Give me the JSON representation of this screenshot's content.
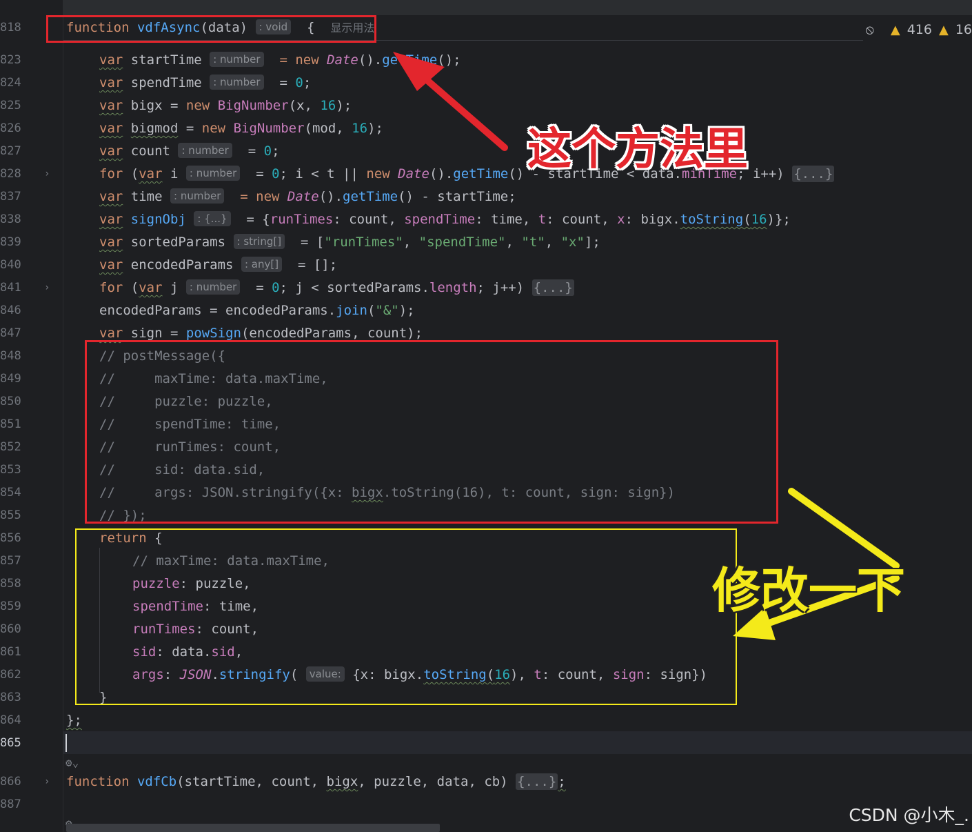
{
  "editor": {
    "inspection": {
      "warnings": "416",
      "weak_warnings": "16"
    },
    "sticky": {
      "line": "818",
      "tokens": [
        "function",
        "vdfAsync",
        "(data)",
        ": void",
        "{",
        "显示用法"
      ]
    },
    "lines": [
      {
        "n": "823",
        "t": [
          "var",
          "startTime",
          ": number",
          "= new",
          "Date",
          "().",
          "getTime",
          "();"
        ]
      },
      {
        "n": "824",
        "t": [
          "var",
          "spendTime",
          ": number",
          "=",
          "0",
          ";"
        ]
      },
      {
        "n": "825",
        "t": [
          "var",
          "bigx",
          "= new",
          "BigNumber",
          "(x,",
          "16",
          ");"
        ]
      },
      {
        "n": "826",
        "t": [
          "var",
          "bigmod",
          "= new",
          "BigNumber",
          "(mod,",
          "16",
          ");"
        ]
      },
      {
        "n": "827",
        "t": [
          "var",
          "count",
          ": number",
          "=",
          "0",
          ";"
        ]
      },
      {
        "n": "828",
        "t": [
          "for",
          "(",
          "var",
          "i",
          ": number",
          "=",
          "0",
          "; i < t ||",
          "new",
          "Date",
          "().",
          "getTime",
          "() - startTime < data.",
          "minTime",
          "; i++)",
          "{...}"
        ]
      },
      {
        "n": "837",
        "t": [
          "var",
          "time",
          ": number",
          "= new",
          "Date",
          "().",
          "getTime",
          "() - startTime;"
        ]
      },
      {
        "n": "838",
        "t": [
          "var",
          "signObj",
          ": {...}",
          "= {",
          "runTimes",
          ": count,",
          "spendTime",
          ": time,",
          "t",
          ": count,",
          "x",
          ": bigx.",
          "toString",
          "(",
          "16",
          ")};"
        ]
      },
      {
        "n": "839",
        "t": [
          "var",
          "sortedParams",
          ": string[]",
          "= [",
          "\"runTimes\"",
          ",",
          "\"spendTime\"",
          ",",
          "\"t\"",
          ",",
          "\"x\"",
          "];"
        ]
      },
      {
        "n": "840",
        "t": [
          "var",
          "encodedParams",
          ": any[]",
          "= [];"
        ]
      },
      {
        "n": "841",
        "t": [
          "for",
          "(",
          "var",
          "j",
          ": number",
          "=",
          "0",
          "; j < sortedParams.",
          "length",
          "; j++)",
          "{...}"
        ]
      },
      {
        "n": "846",
        "t": [
          "encodedParams = encodedParams.",
          "join",
          "(",
          "\"&\"",
          ");"
        ]
      },
      {
        "n": "847",
        "t": [
          "var",
          "sign =",
          "powSign",
          "(encodedParams, count);"
        ]
      },
      {
        "n": "848",
        "t": [
          "// postMessage({"
        ]
      },
      {
        "n": "849",
        "t": [
          "//     maxTime: data.maxTime,"
        ]
      },
      {
        "n": "850",
        "t": [
          "//     puzzle: puzzle,"
        ]
      },
      {
        "n": "851",
        "t": [
          "//     spendTime: time,"
        ]
      },
      {
        "n": "852",
        "t": [
          "//     runTimes: count,"
        ]
      },
      {
        "n": "853",
        "t": [
          "//     sid: data.sid,"
        ]
      },
      {
        "n": "854",
        "t": [
          "//     args: JSON.stringify({x: ",
          "bigx",
          ".toString(16), t: count, sign: sign})"
        ]
      },
      {
        "n": "855",
        "t": [
          "// });"
        ]
      },
      {
        "n": "856",
        "t": [
          "return",
          "{"
        ]
      },
      {
        "n": "857",
        "t": [
          "// maxTime: data.maxTime,"
        ]
      },
      {
        "n": "858",
        "t": [
          "puzzle",
          ": puzzle,"
        ]
      },
      {
        "n": "859",
        "t": [
          "spendTime",
          ": time,"
        ]
      },
      {
        "n": "860",
        "t": [
          "runTimes",
          ": count,"
        ]
      },
      {
        "n": "861",
        "t": [
          "sid",
          ": data.",
          "sid",
          ","
        ]
      },
      {
        "n": "862",
        "t": [
          "args",
          ":",
          "JSON",
          ".",
          "stringify",
          "(",
          "value:",
          "{x: bigx.",
          "toString",
          "(",
          "16",
          "),",
          "t",
          ": count,",
          "sign",
          ": sign})"
        ]
      },
      {
        "n": "863",
        "t": [
          "}"
        ]
      },
      {
        "n": "864",
        "t": [
          "};"
        ]
      },
      {
        "n": "865",
        "t": [
          ""
        ]
      },
      {
        "n": "866",
        "t": [
          "function",
          "vdfCb",
          "(startTime, count,",
          "bigx",
          ", puzzle, data, cb)",
          "{...}",
          ";"
        ]
      },
      {
        "n": "887",
        "t": [
          ""
        ]
      }
    ]
  },
  "annotations": {
    "red_label": "这个方法里",
    "yellow_label": "修改一下"
  },
  "watermark": "CSDN @小木_.",
  "colors": {
    "background": "#1e1f22",
    "keyword": "#cf8e6d",
    "function": "#56a8f5",
    "number": "#2aacb8",
    "string": "#6aab73",
    "property": "#c77dbb",
    "comment": "#7a7e85",
    "annotation_red": "#e3262d",
    "annotation_yellow": "#f4ea1a"
  }
}
